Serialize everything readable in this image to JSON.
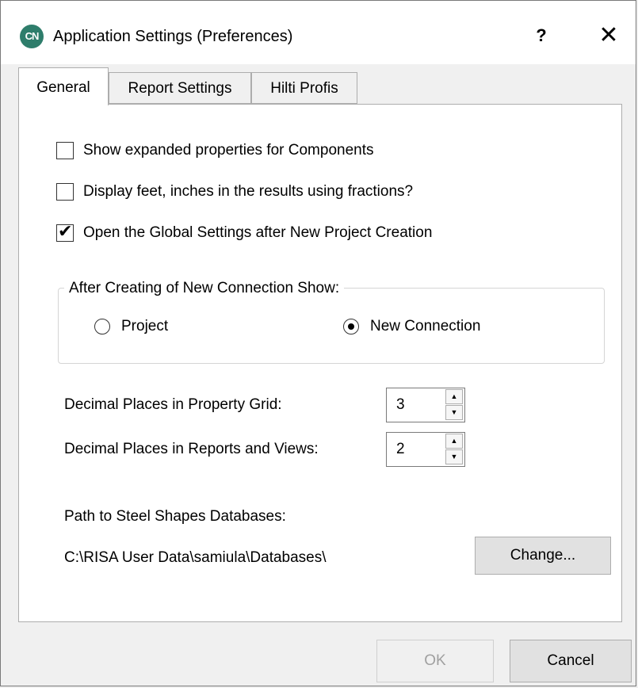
{
  "window": {
    "title": "Application Settings (Preferences)",
    "icon_text": "CN",
    "help_label": "?",
    "close_label": "✕"
  },
  "tabs": [
    {
      "label": "General",
      "active": true
    },
    {
      "label": "Report Settings",
      "active": false
    },
    {
      "label": "Hilti Profis",
      "active": false
    }
  ],
  "general": {
    "checkboxes": [
      {
        "label": "Show expanded properties for Components",
        "checked": false
      },
      {
        "label": "Display feet, inches in the results using fractions?",
        "checked": false
      },
      {
        "label": "Open the Global Settings after New Project Creation",
        "checked": true
      }
    ],
    "group": {
      "title": "After Creating of New Connection Show:",
      "options": [
        {
          "label": "Project",
          "selected": false
        },
        {
          "label": "New Connection",
          "selected": true
        }
      ]
    },
    "decimal_property_grid": {
      "label": "Decimal Places in Property Grid:",
      "value": "3"
    },
    "decimal_reports": {
      "label": "Decimal Places in Reports and Views:",
      "value": "2"
    },
    "path": {
      "label": "Path to Steel Shapes Databases:",
      "value": "C:\\RISA User Data\\samiula\\Databases\\",
      "change_label": "Change..."
    }
  },
  "buttons": {
    "ok_label": "OK",
    "cancel_label": "Cancel"
  },
  "icons": {
    "check": "✔",
    "spin_up": "▲",
    "spin_down": "▼"
  }
}
